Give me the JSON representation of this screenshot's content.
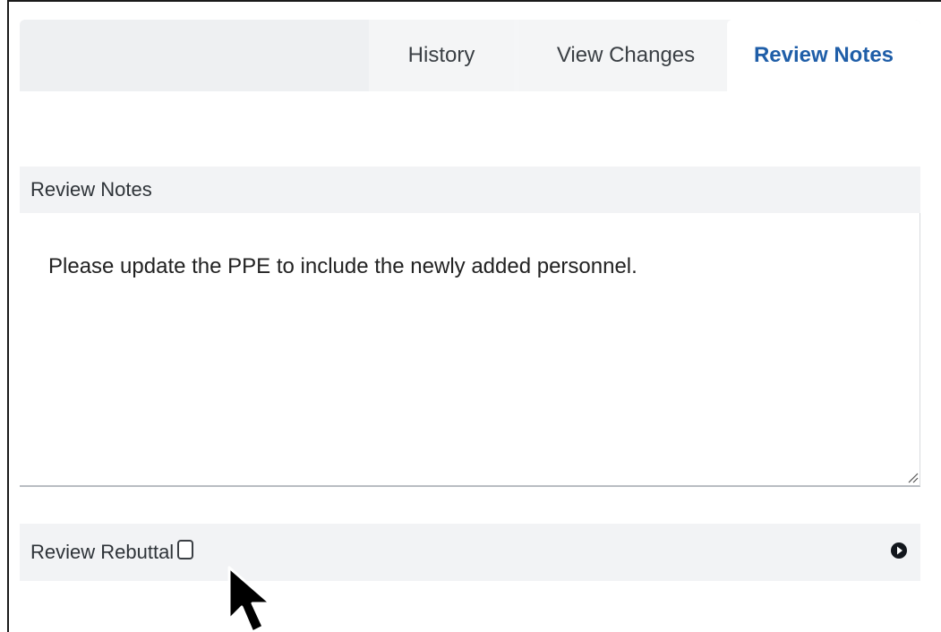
{
  "tabs": [
    {
      "label": "History",
      "active": false
    },
    {
      "label": "View Changes",
      "active": false
    },
    {
      "label": "Review Notes",
      "active": true
    }
  ],
  "review_notes": {
    "header": "Review Notes",
    "text": "Please update the PPE to include the newly added personnel."
  },
  "rebuttal": {
    "label": "Review Rebuttal",
    "checked": false
  },
  "colors": {
    "active_tab_text": "#1f5ea8",
    "section_background": "#f2f3f5"
  },
  "icons": {
    "expand": "play-circle-icon",
    "resize": "resize-grip-icon",
    "pointer": "mouse-pointer-icon"
  }
}
